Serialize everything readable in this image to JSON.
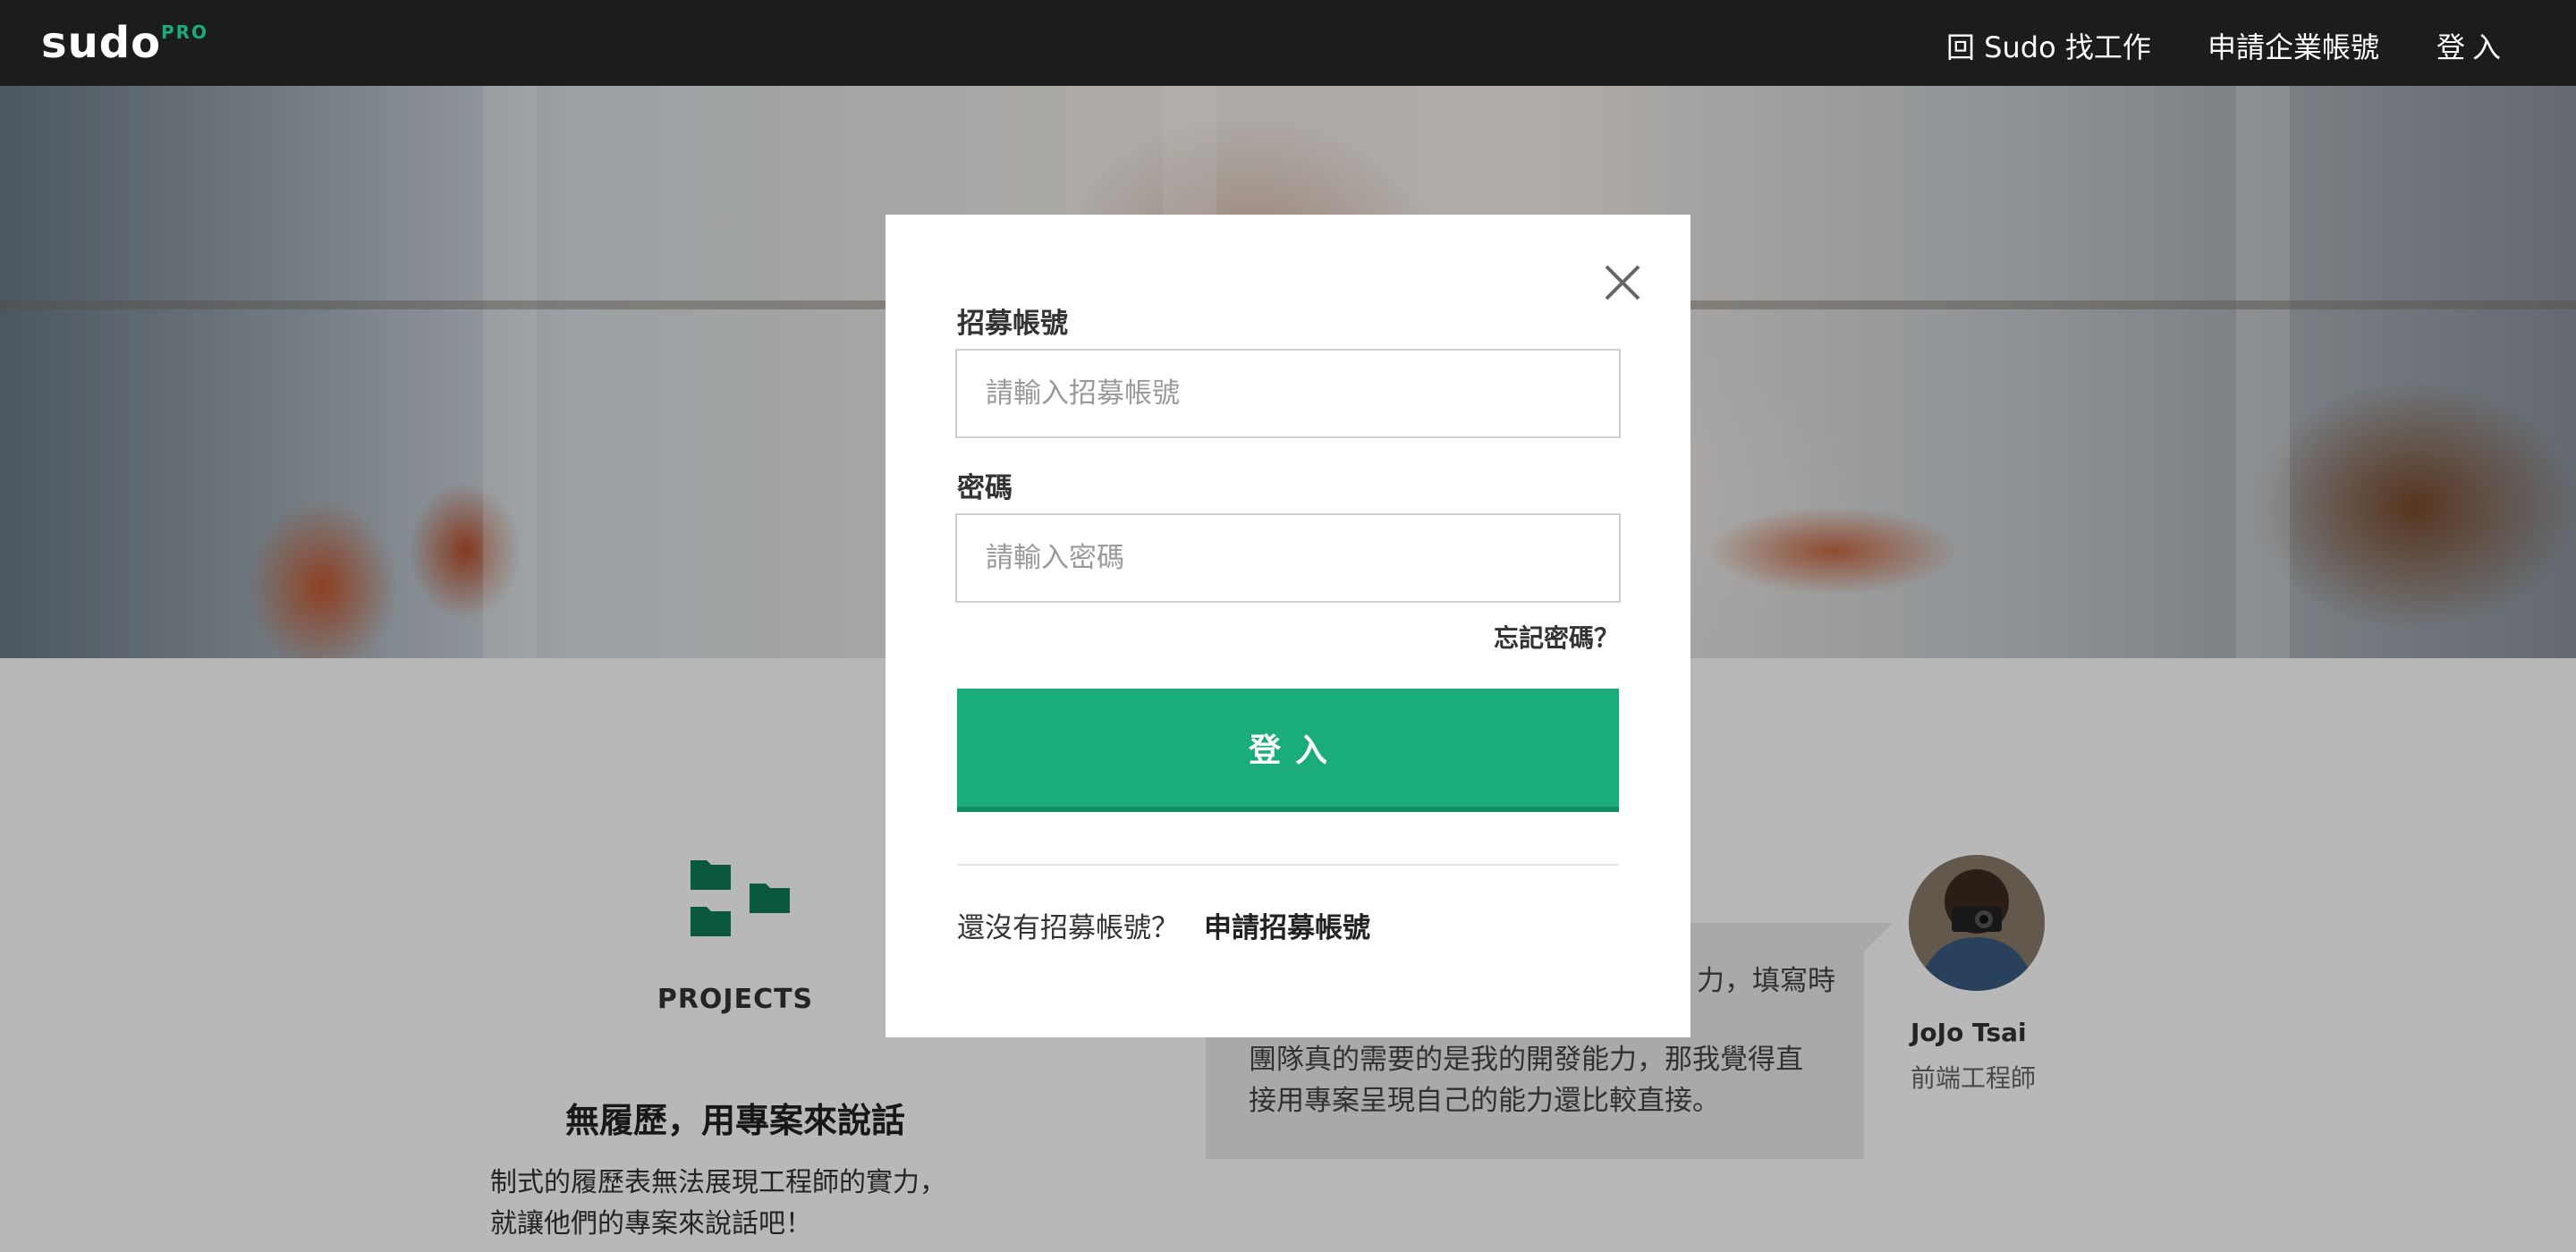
{
  "nav": {
    "logo": "sudo",
    "logo_badge": "PRO",
    "back_link": "回 Sudo 找工作",
    "apply_link": "申請企業帳號",
    "login_link": "登入"
  },
  "feature": {
    "icon": "folder-icon",
    "label": "PROJECTS",
    "title": "無履歷，用專案來說話",
    "desc_line1": "制式的履歷表無法展現工程師的實力，",
    "desc_line2": "就讓他們的專案來說話吧！"
  },
  "testimonial": {
    "quote_line1": "力，填寫時",
    "quote_line2": "團隊真的需要的是我的開發能力，那我覺得直",
    "quote_line3": "接用專案呈現自己的能力還比較直接。",
    "name": "JoJo Tsai",
    "role": "前端工程師"
  },
  "modal": {
    "account_label": "招募帳號",
    "account_placeholder": "請輸入招募帳號",
    "account_value": "",
    "password_label": "密碼",
    "password_placeholder": "請輸入密碼",
    "password_value": "",
    "forgot": "忘記密碼？",
    "login_button": "登入",
    "signup_prompt": "還沒有招募帳號？",
    "signup_link": "申請招募帳號",
    "close_icon": "close-icon"
  },
  "colors": {
    "brand_green": "#1aad7b",
    "nav_bg": "#1c1c1c",
    "icon_green": "#0f7a55"
  }
}
